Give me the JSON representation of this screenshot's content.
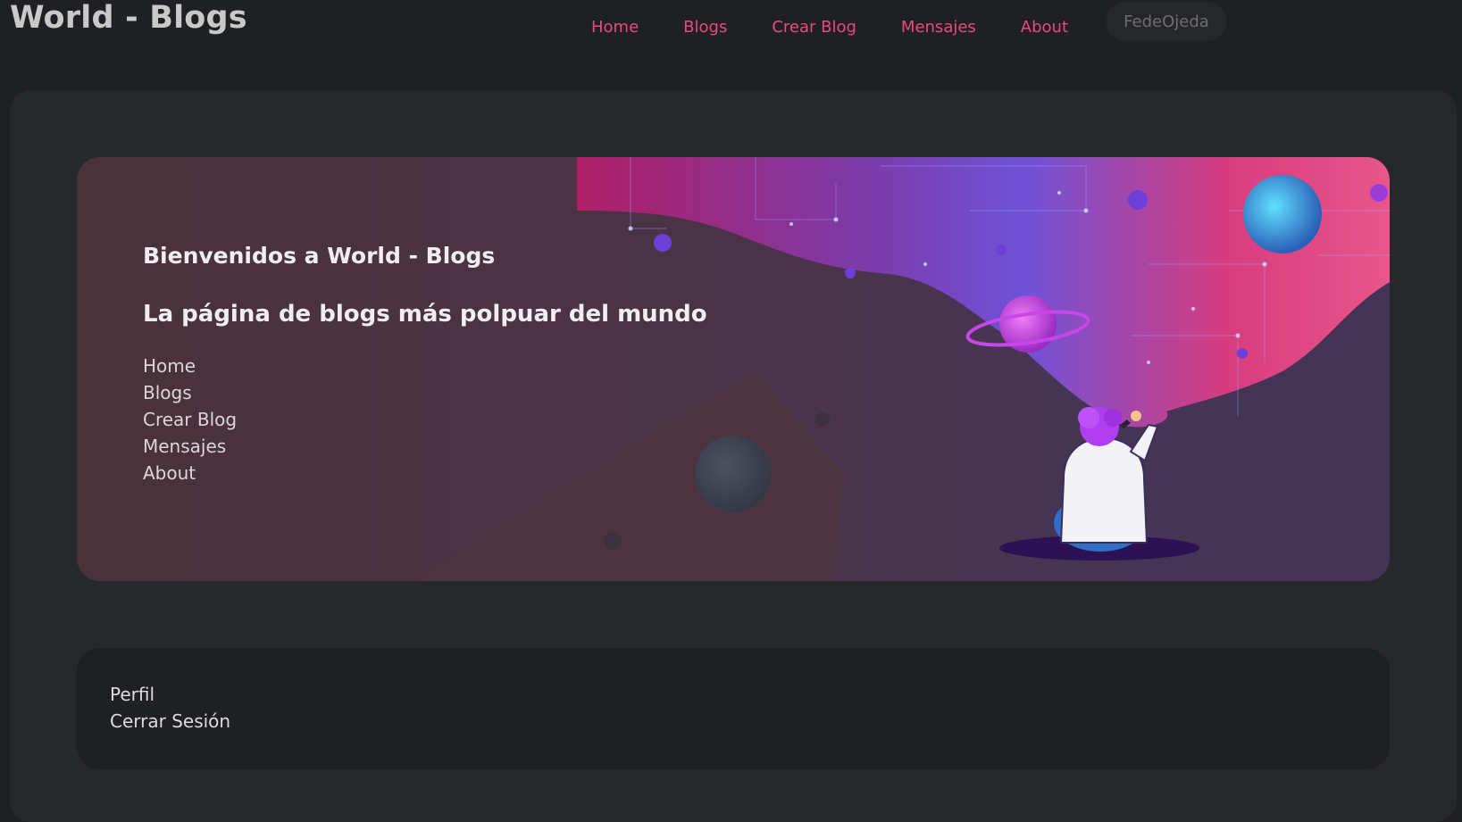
{
  "brand": {
    "title": "World - Blogs"
  },
  "nav": {
    "items": [
      {
        "label": "Home"
      },
      {
        "label": "Blogs"
      },
      {
        "label": "Crear Blog"
      },
      {
        "label": "Mensajes"
      },
      {
        "label": "About"
      }
    ],
    "user": "FedeOjeda"
  },
  "hero": {
    "title": "Bienvenidos a World - Blogs",
    "subtitle": "La página de blogs más polpuar del mundo",
    "links": [
      {
        "label": "Home"
      },
      {
        "label": "Blogs"
      },
      {
        "label": "Crear Blog"
      },
      {
        "label": "Mensajes"
      },
      {
        "label": "About"
      }
    ]
  },
  "footer": {
    "links": [
      {
        "label": "Perfil"
      },
      {
        "label": "Cerrar Sesión"
      }
    ]
  },
  "colors": {
    "accent": "#ea4a7c",
    "background": "#1f2023",
    "panel": "#27282b"
  }
}
